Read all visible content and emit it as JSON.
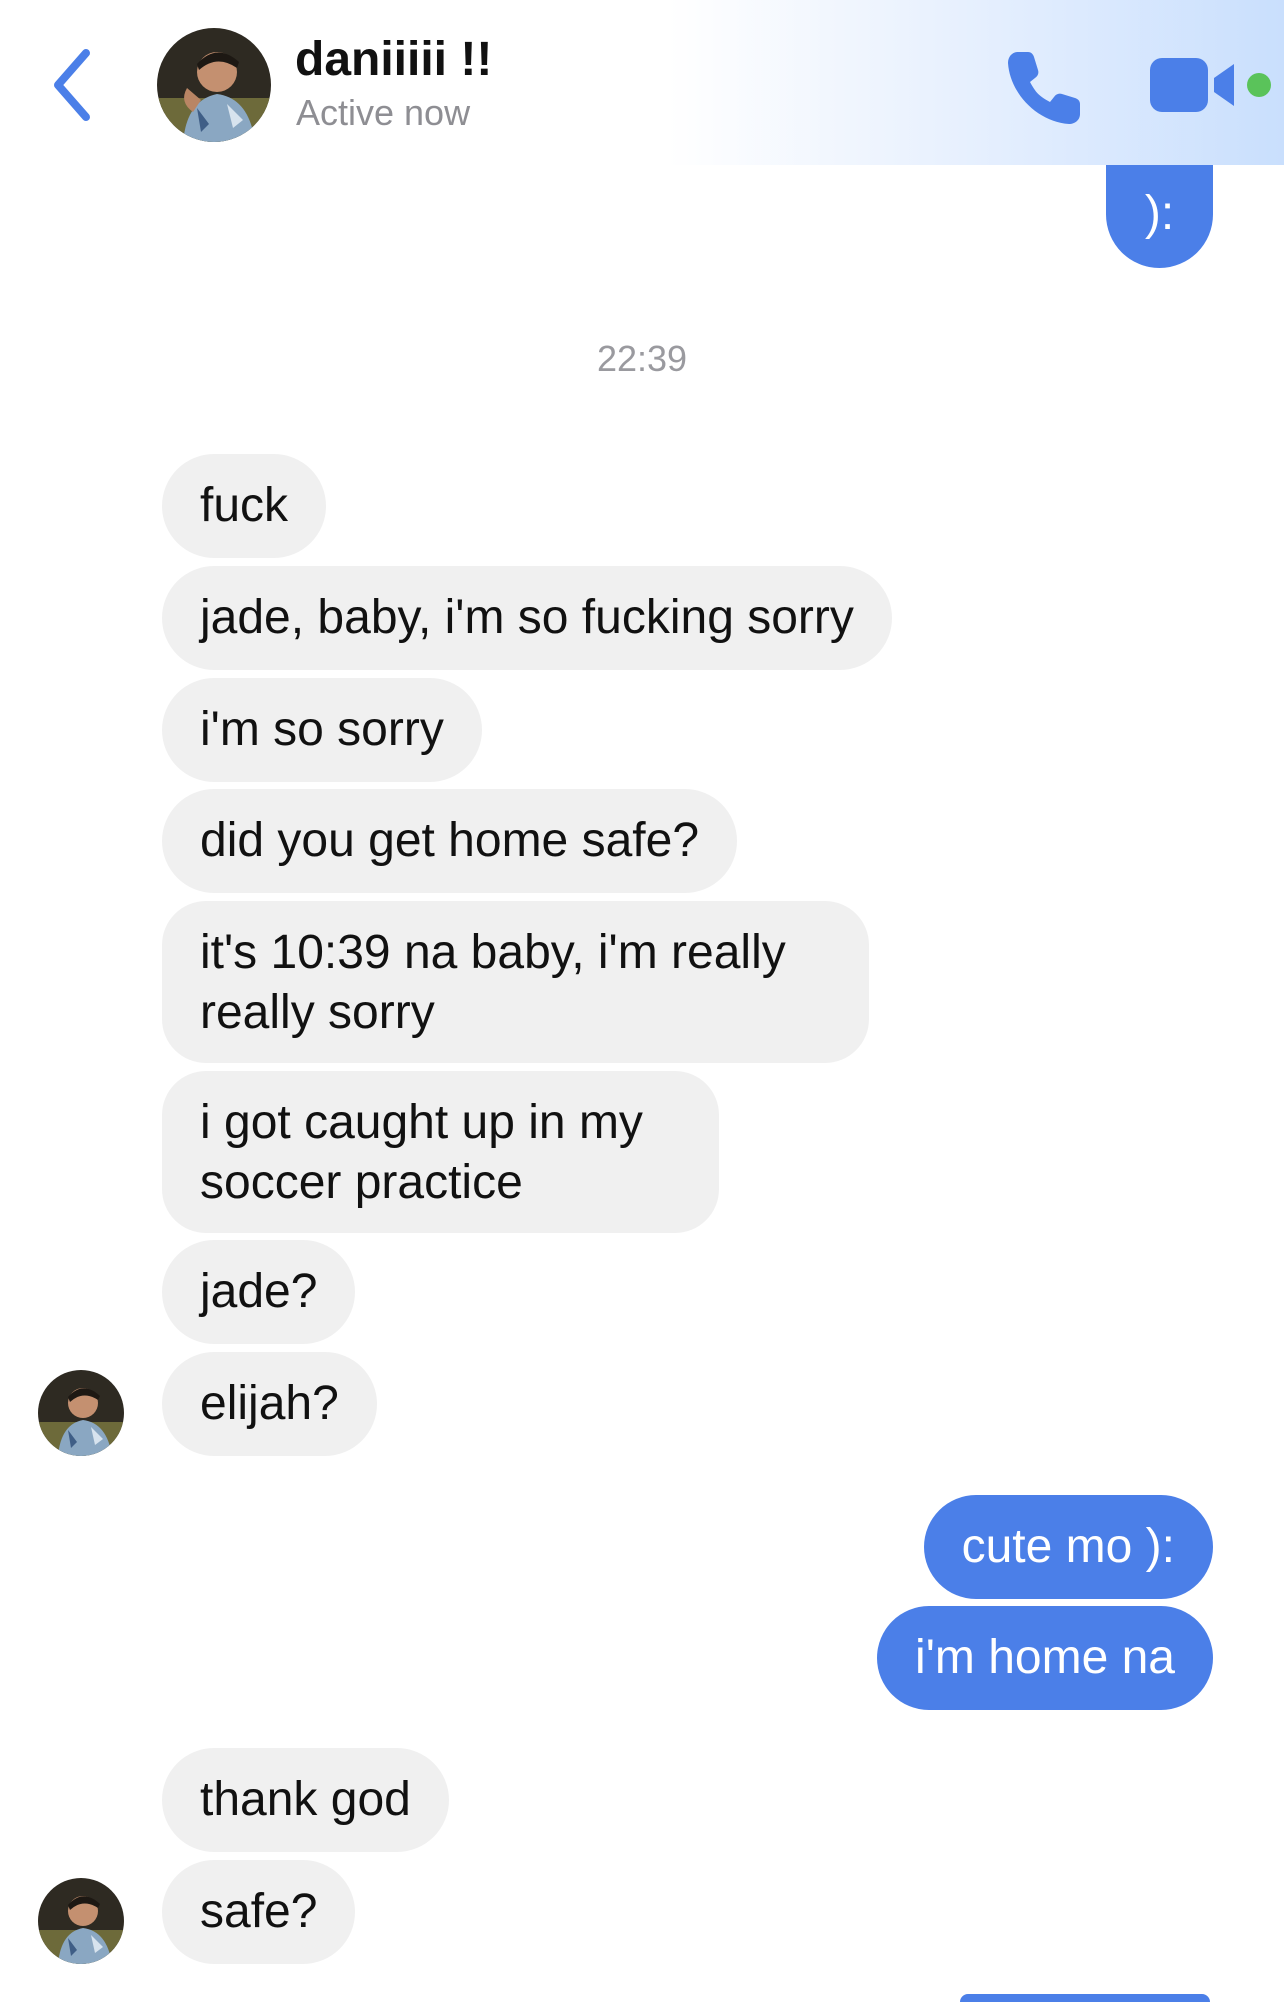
{
  "header": {
    "contact_name": "daniiiii !!",
    "status": "Active now",
    "back_icon": "chevron-left-icon",
    "call_icon": "phone-icon",
    "video_icon": "video-camera-icon",
    "accent_color": "#4b7fe8",
    "active_dot_color": "#5ac35a"
  },
  "conversation": {
    "timestamp": "22:39",
    "messages": [
      {
        "sender": "me",
        "text": "):"
      },
      {
        "sender": "them",
        "text": "fuck"
      },
      {
        "sender": "them",
        "text": "jade, baby, i'm so fucking sorry"
      },
      {
        "sender": "them",
        "text": "i'm so sorry"
      },
      {
        "sender": "them",
        "text": "did you get home safe?"
      },
      {
        "sender": "them",
        "text": "it's 10:39 na baby, i'm really really sorry"
      },
      {
        "sender": "them",
        "text": "i got caught up in my soccer practice"
      },
      {
        "sender": "them",
        "text": "jade?"
      },
      {
        "sender": "them",
        "text": "elijah?"
      },
      {
        "sender": "me",
        "text": "cute mo ):"
      },
      {
        "sender": "me",
        "text": "i'm home na"
      },
      {
        "sender": "them",
        "text": "thank god"
      },
      {
        "sender": "them",
        "text": "safe?"
      }
    ]
  },
  "colors": {
    "outgoing_bubble": "#4b7fe8",
    "incoming_bubble": "#f0f0f0"
  }
}
